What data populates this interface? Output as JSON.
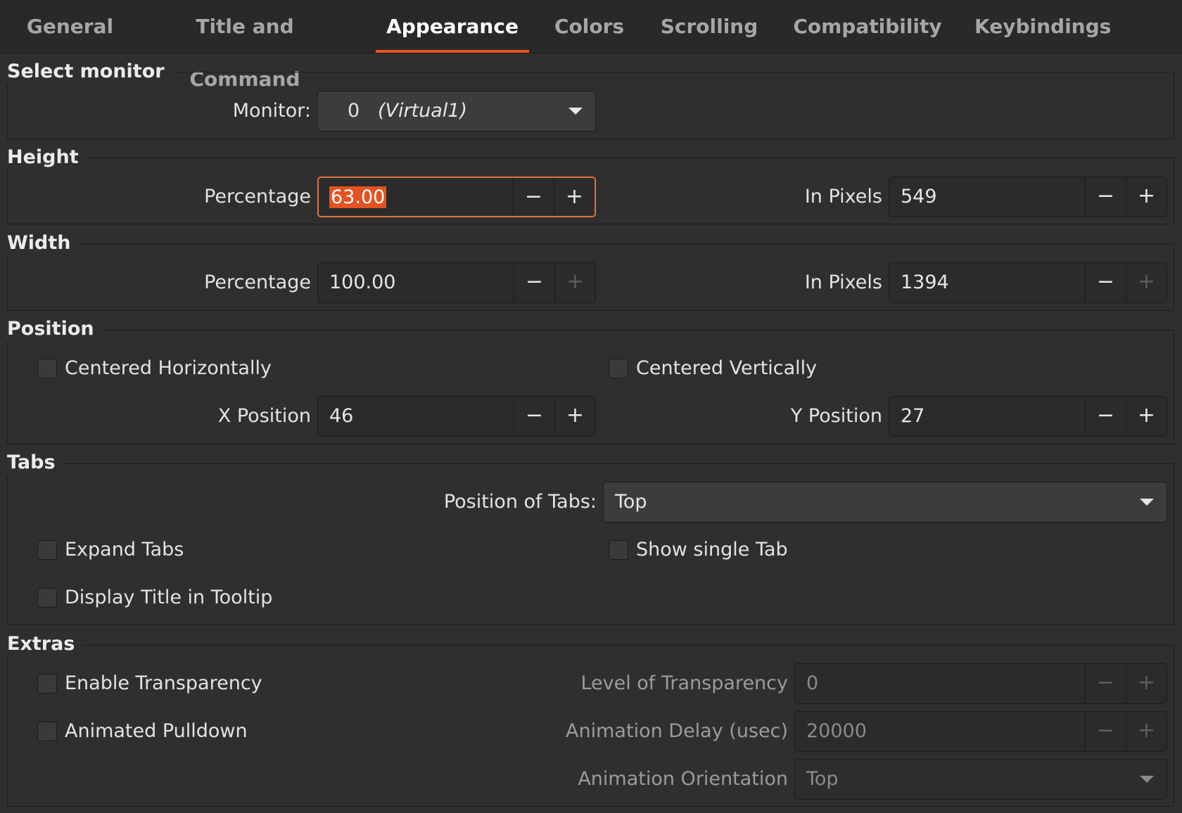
{
  "tabs": [
    {
      "label": "General",
      "active": false
    },
    {
      "label": "Title and Command",
      "active": false
    },
    {
      "label": "Appearance",
      "active": true
    },
    {
      "label": "Colors",
      "active": false
    },
    {
      "label": "Scrolling",
      "active": false
    },
    {
      "label": "Compatibility",
      "active": false
    },
    {
      "label": "Keybindings",
      "active": false
    }
  ],
  "select_monitor": {
    "title": "Select monitor",
    "monitor_label": "Monitor:",
    "monitor_index": "0",
    "monitor_name": "(Virtual1)"
  },
  "height": {
    "title": "Height",
    "percentage_label": "Percentage",
    "percentage_value": "63.00",
    "pixels_label": "In Pixels",
    "pixels_value": "549"
  },
  "width": {
    "title": "Width",
    "percentage_label": "Percentage",
    "percentage_value": "100.00",
    "pixels_label": "In Pixels",
    "pixels_value": "1394"
  },
  "position": {
    "title": "Position",
    "centered_h_label": "Centered Horizontally",
    "centered_v_label": "Centered Vertically",
    "x_label": "X Position",
    "x_value": "46",
    "y_label": "Y Position",
    "y_value": "27"
  },
  "tabs_section": {
    "title": "Tabs",
    "position_label": "Position of Tabs:",
    "position_value": "Top",
    "expand_label": "Expand Tabs",
    "single_label": "Show single Tab",
    "tooltip_label": "Display Title in Tooltip"
  },
  "extras": {
    "title": "Extras",
    "transparency_label": "Enable Transparency",
    "pulldown_label": "Animated Pulldown",
    "level_label": "Level of Transparency",
    "level_value": "0",
    "delay_label": "Animation Delay (usec)",
    "delay_value": "20000",
    "orientation_label": "Animation Orientation",
    "orientation_value": "Top"
  },
  "colors": {
    "accent": "#e95420",
    "background": "#2f2f2f"
  },
  "icons": {
    "minus": "minus-icon",
    "plus": "plus-icon",
    "dropdown": "chevron-down-icon"
  }
}
